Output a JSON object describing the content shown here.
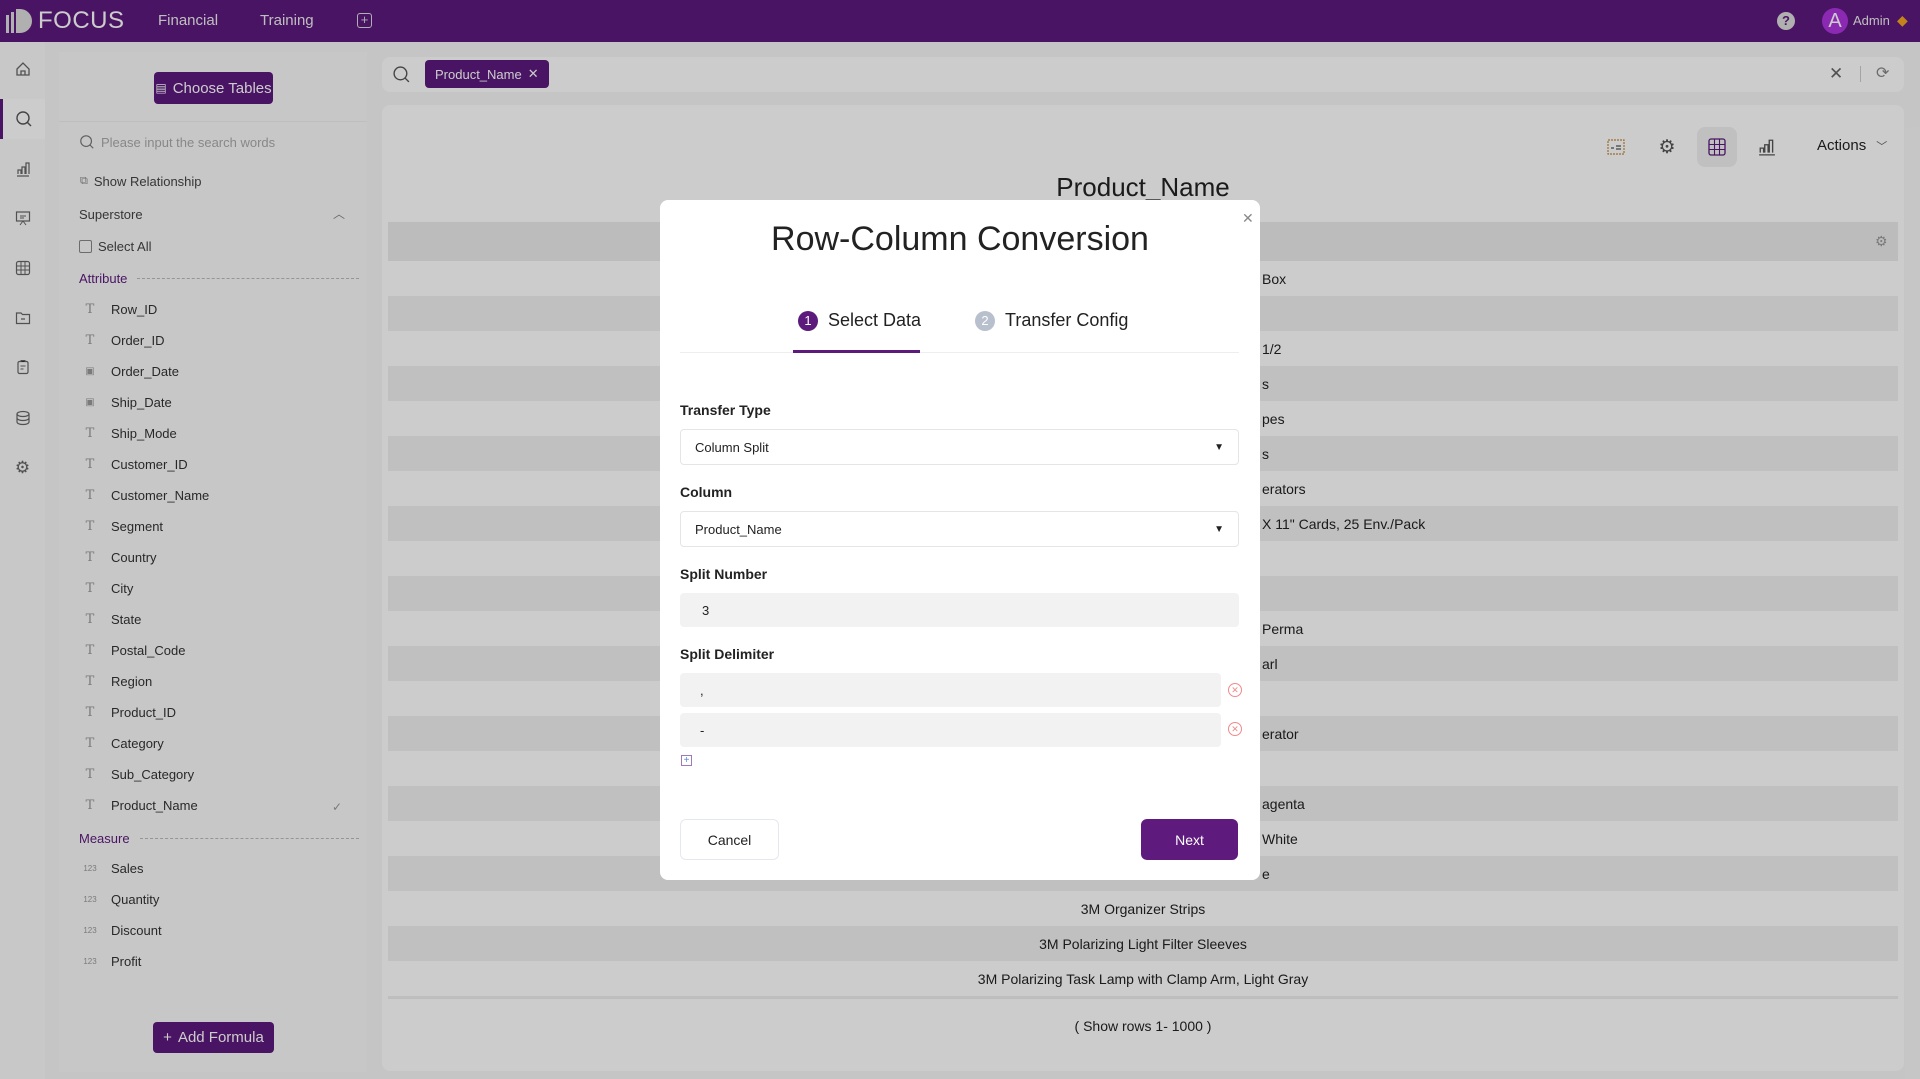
{
  "colors": {
    "brand": "#5c1a7c",
    "danger": "#f08a8a"
  },
  "topbar": {
    "logo": "FOCUS",
    "nav": [
      "Financial",
      "Training"
    ],
    "add_tab_icon": "plus-square-icon",
    "help_icon": "question-icon",
    "user_initial": "A",
    "user_name": "Admin",
    "badge_icon": "diamond-icon"
  },
  "rail": {
    "icons": [
      "home-icon",
      "search-icon",
      "chart-icon",
      "presentation-icon",
      "table-icon",
      "folder-icon",
      "clipboard-icon",
      "database-icon",
      "gear-icon"
    ],
    "active": 1
  },
  "sidebar": {
    "choose_tables": "Choose Tables",
    "search_placeholder": "Please input the search words",
    "show_relationship": "Show Relationship",
    "table_name": "Superstore",
    "select_all": "Select All",
    "attribute_label": "Attribute",
    "attributes": [
      {
        "name": "Row_ID",
        "type": "text"
      },
      {
        "name": "Order_ID",
        "type": "text"
      },
      {
        "name": "Order_Date",
        "type": "date"
      },
      {
        "name": "Ship_Date",
        "type": "date"
      },
      {
        "name": "Ship_Mode",
        "type": "text"
      },
      {
        "name": "Customer_ID",
        "type": "text"
      },
      {
        "name": "Customer_Name",
        "type": "text"
      },
      {
        "name": "Segment",
        "type": "text"
      },
      {
        "name": "Country",
        "type": "text"
      },
      {
        "name": "City",
        "type": "text"
      },
      {
        "name": "State",
        "type": "text"
      },
      {
        "name": "Postal_Code",
        "type": "text"
      },
      {
        "name": "Region",
        "type": "text"
      },
      {
        "name": "Product_ID",
        "type": "text"
      },
      {
        "name": "Category",
        "type": "text"
      },
      {
        "name": "Sub_Category",
        "type": "text"
      },
      {
        "name": "Product_Name",
        "type": "text",
        "selected": true
      }
    ],
    "measure_label": "Measure",
    "measures": [
      "Sales",
      "Quantity",
      "Discount",
      "Profit"
    ],
    "add_formula": "Add Formula"
  },
  "search": {
    "chip": "Product_Name"
  },
  "toolbar": {
    "actions": "Actions"
  },
  "table": {
    "title": "Product_Name",
    "rows": [
      "Box",
      "",
      "1/2",
      "s",
      "pes",
      "s",
      "erators",
      "X 11\" Cards, 25 Env./Pack",
      "",
      "",
      "Perma",
      "arl",
      "",
      "erator",
      "",
      "agenta",
      "White",
      "e",
      "3M Organizer Strips",
      "3M Polarizing Light Filter Sleeves",
      "3M Polarizing Task Lamp with Clamp Arm, Light Gray"
    ],
    "footer": "( Show rows 1- 1000 )"
  },
  "modal": {
    "title": "Row-Column Conversion",
    "steps": [
      {
        "num": "1",
        "label": "Select Data",
        "active": true
      },
      {
        "num": "2",
        "label": "Transfer Config",
        "active": false
      }
    ],
    "transfer_type_label": "Transfer Type",
    "transfer_type": "Column Split",
    "column_label": "Column",
    "column": "Product_Name",
    "split_number_label": "Split Number",
    "split_number": "3",
    "split_delimiter_label": "Split Delimiter",
    "delimiters": [
      ",",
      "-"
    ],
    "cancel": "Cancel",
    "next": "Next"
  }
}
